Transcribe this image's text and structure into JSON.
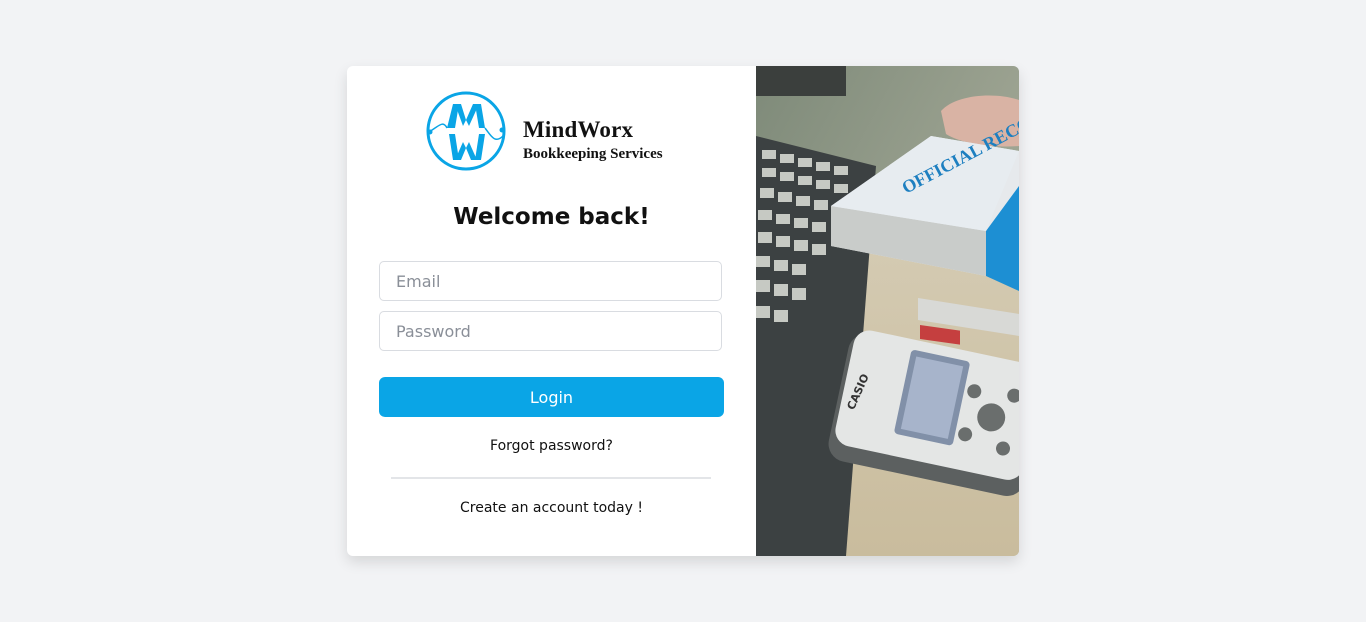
{
  "brand": {
    "name": "MindWorx",
    "subtitle": "Bookkeeping Services",
    "accent_color": "#0aa5e6"
  },
  "login_form": {
    "heading": "Welcome back!",
    "email_placeholder": "Email",
    "password_placeholder": "Password",
    "login_label": "Login",
    "forgot_label": "Forgot password?",
    "create_account_label": "Create an account today !"
  },
  "side_image": {
    "book_text": "OFFICIAL RECORD BOOK",
    "calculator_brand": "CASIO"
  }
}
